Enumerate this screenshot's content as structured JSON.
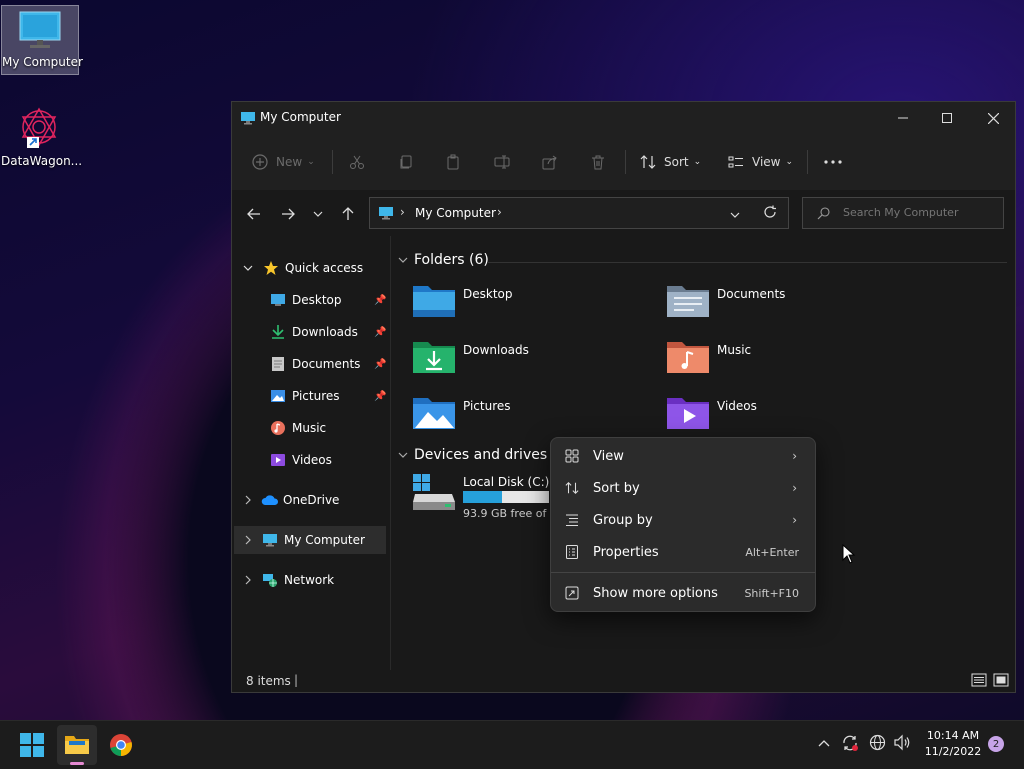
{
  "desktop": {
    "icons": [
      {
        "label": "My Computer"
      },
      {
        "label": "DataWagon..."
      }
    ]
  },
  "window": {
    "title": "My Computer",
    "toolbar": {
      "new_label": "New",
      "sort_label": "Sort",
      "view_label": "View"
    },
    "address": {
      "location": "My Computer"
    },
    "search": {
      "placeholder": "Search My Computer"
    },
    "sidebar": {
      "quick_access": "Quick access",
      "items": [
        {
          "label": "Desktop"
        },
        {
          "label": "Downloads"
        },
        {
          "label": "Documents"
        },
        {
          "label": "Pictures"
        },
        {
          "label": "Music"
        },
        {
          "label": "Videos"
        }
      ],
      "onedrive": "OneDrive",
      "my_computer": "My Computer",
      "network": "Network"
    },
    "content": {
      "folders_header": "Folders (6)",
      "folders": [
        {
          "name": "Desktop"
        },
        {
          "name": "Documents"
        },
        {
          "name": "Downloads"
        },
        {
          "name": "Music"
        },
        {
          "name": "Pictures"
        },
        {
          "name": "Videos"
        }
      ],
      "devices_header": "Devices and drives (2",
      "drive": {
        "name": "Local Disk (C:)",
        "free": "93.9 GB free of 1",
        "used_fraction": 0.45
      }
    },
    "status": {
      "items": "8 items"
    }
  },
  "context_menu": {
    "items": [
      {
        "label": "View"
      },
      {
        "label": "Sort by"
      },
      {
        "label": "Group by"
      },
      {
        "label": "Properties",
        "shortcut": "Alt+Enter"
      },
      {
        "label": "Show more options",
        "shortcut": "Shift+F10"
      }
    ]
  },
  "taskbar": {
    "time": "10:14 AM",
    "date": "11/2/2022",
    "notification_count": "2"
  },
  "colors": {
    "accent": "#4cc2ff",
    "window_bg": "#191919",
    "menu_bg": "#2b2b2b",
    "drive_bar": "#26a0da"
  }
}
